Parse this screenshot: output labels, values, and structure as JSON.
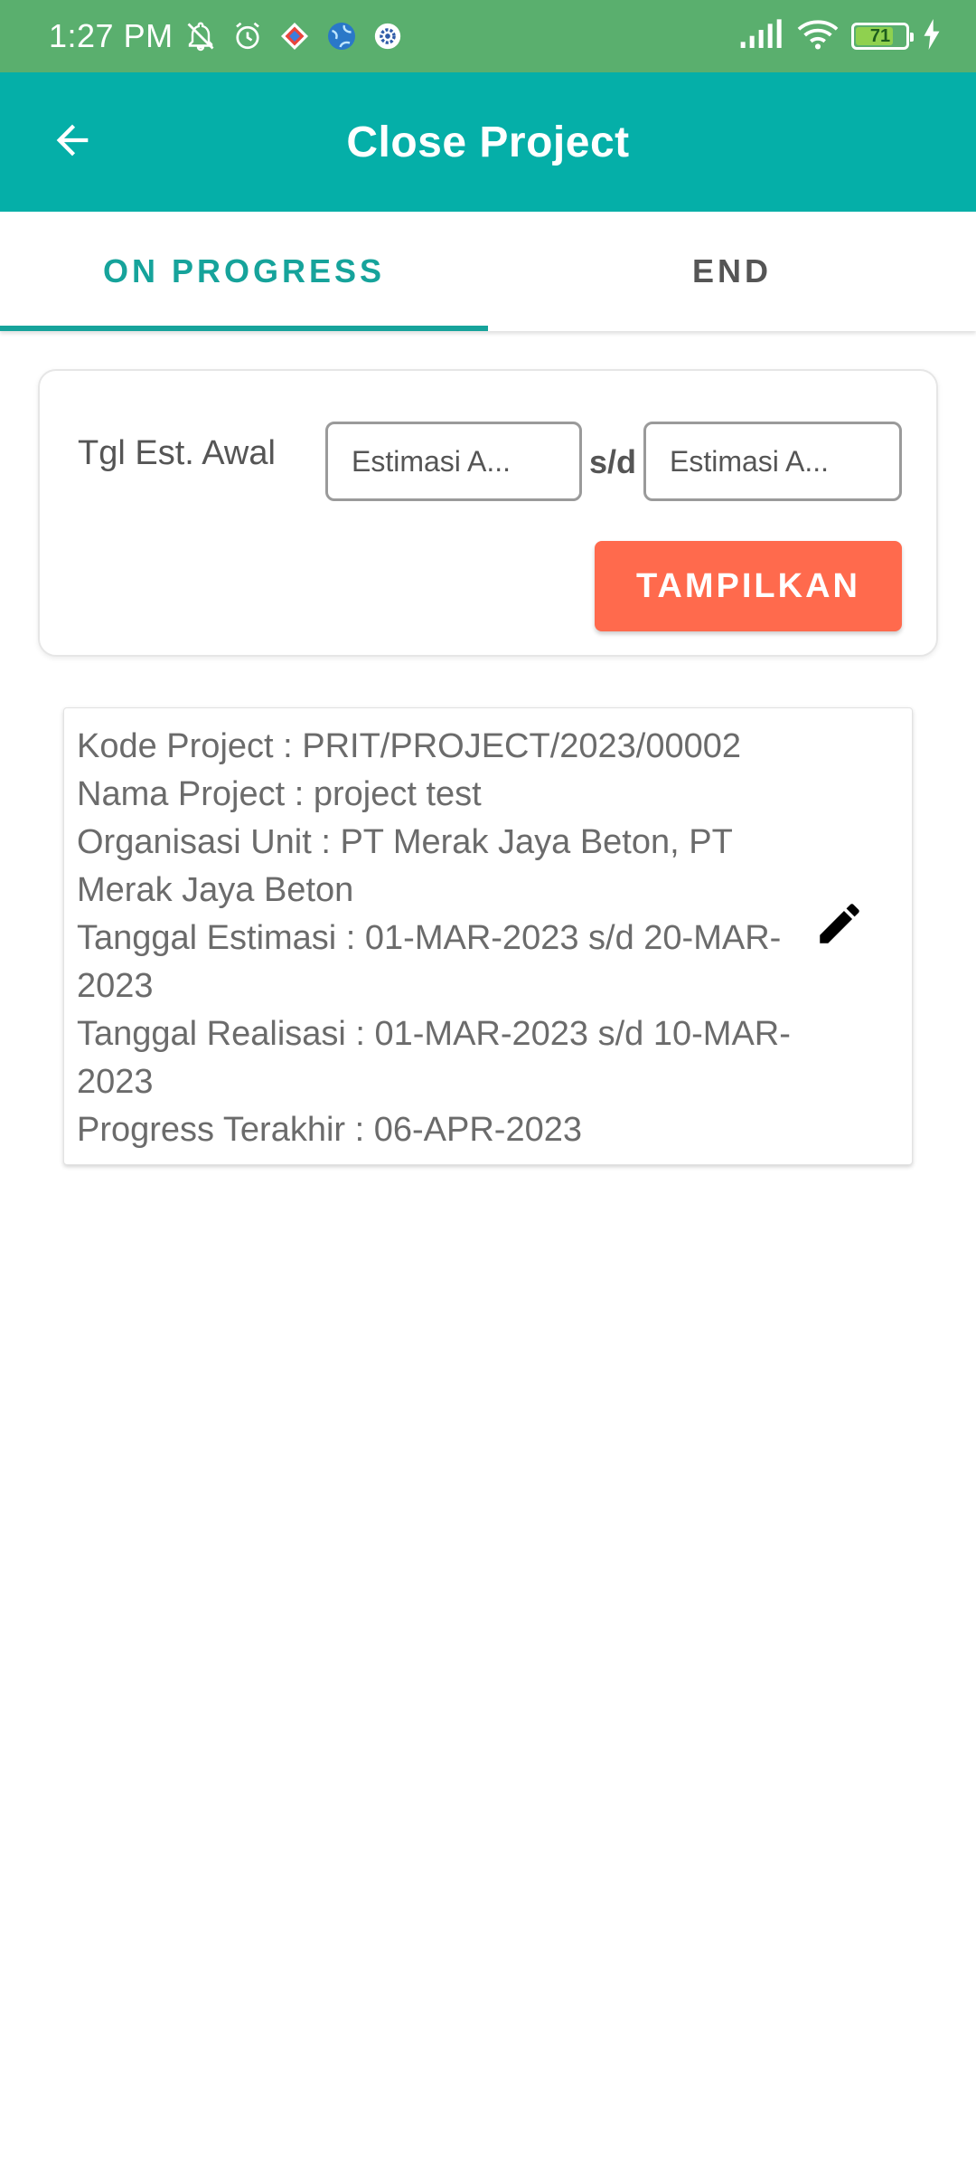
{
  "status_bar": {
    "time": "1:27 PM",
    "battery_level": "71",
    "icons": [
      "notifications-off-icon",
      "alarm-icon",
      "app-diamond-icon",
      "globe-icon",
      "gear-icon",
      "signal-icon",
      "wifi-icon",
      "battery-icon",
      "charging-icon"
    ]
  },
  "app_bar": {
    "title": "Close Project",
    "back_icon": "arrow-left-icon"
  },
  "tabs": [
    {
      "label": "ON PROGRESS",
      "active": true
    },
    {
      "label": "END",
      "active": false
    }
  ],
  "filter": {
    "label": "Tgl Est. Awal",
    "from_placeholder": "Estimasi A...",
    "separator": "s/d",
    "to_placeholder": "Estimasi A...",
    "button_label": "TAMPILKAN"
  },
  "projects": [
    {
      "kode": "Kode Project : PRIT/PROJECT/2023/00002",
      "nama": "Nama Project : project test",
      "organisasi": "Organisasi Unit : PT Merak Jaya Beton, PT Merak Jaya Beton",
      "estimasi": "Tanggal Estimasi : 01-MAR-2023 s/d 20-MAR-2023",
      "realisasi": "Tanggal Realisasi : 01-MAR-2023 s/d 10-MAR-2023",
      "progress": "Progress Terakhir : 06-APR-2023",
      "action_icon": "edit-icon"
    }
  ],
  "colors": {
    "status_bar": "#5aaf6e",
    "app_bar": "#05afa8",
    "tab_active": "#16a39b",
    "button": "#ff6a4d"
  }
}
